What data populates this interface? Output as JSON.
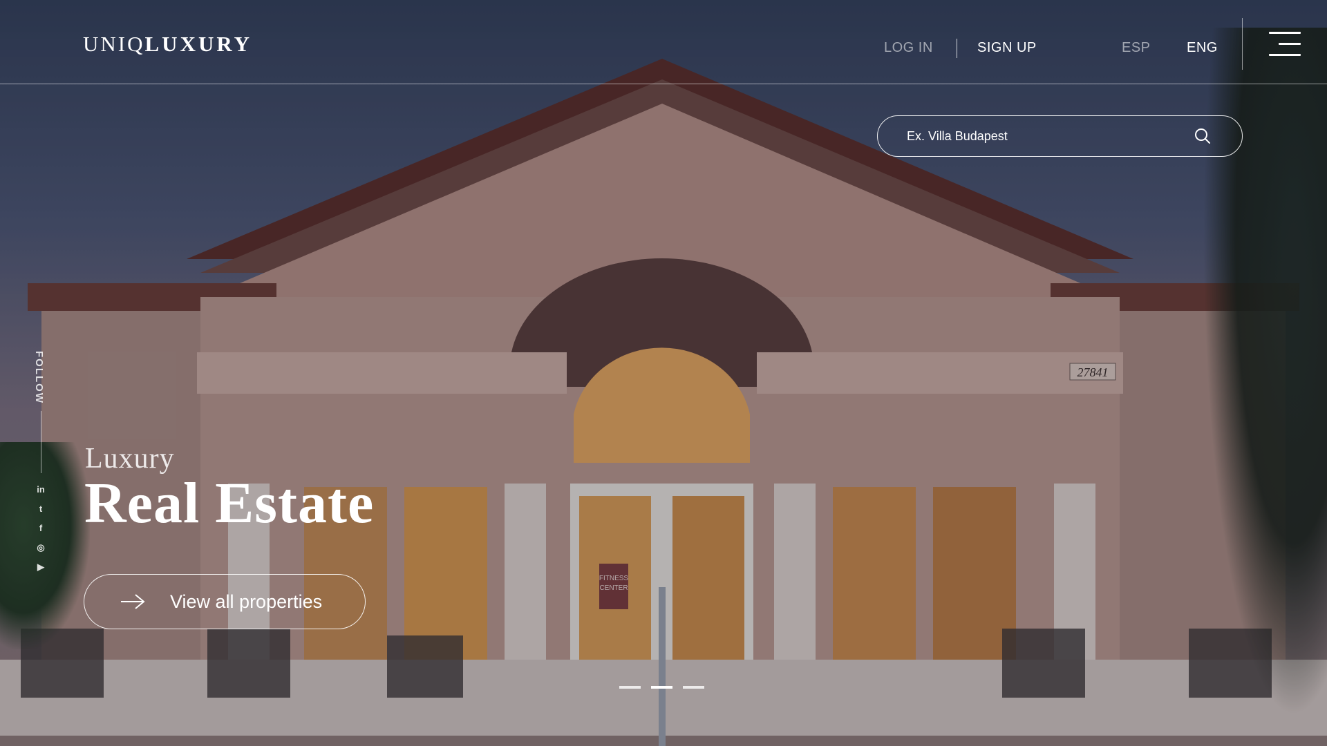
{
  "brand": {
    "logo_thin": "UNIQ",
    "logo_bold": "LUXURY"
  },
  "header": {
    "login_label": "LOG IN",
    "signup_label": "SIGN UP",
    "lang_es": "ESP",
    "lang_en": "ENG",
    "menu_icon": "hamburger-menu-icon"
  },
  "search": {
    "placeholder": "Ex. Villa Budapest",
    "icon": "search-icon"
  },
  "follow": {
    "label": "FOLLOW",
    "socials": [
      {
        "name": "linkedin-icon",
        "glyph": "in"
      },
      {
        "name": "twitter-icon",
        "glyph": "t"
      },
      {
        "name": "facebook-icon",
        "glyph": "f"
      },
      {
        "name": "instagram-icon",
        "glyph": "◎"
      },
      {
        "name": "youtube-icon",
        "glyph": "▶"
      }
    ]
  },
  "hero": {
    "subtitle": "Luxury",
    "title": "Real Estate",
    "cta_label": "View all properties",
    "cta_icon": "arrow-right-icon"
  },
  "slider": {
    "count": 3,
    "active_index": 1
  },
  "scene": {
    "house_number": "27841",
    "sign_text_1": "FITNESS",
    "sign_text_2": "CENTER"
  },
  "colors": {
    "text": "#ffffff",
    "dim_text": "rgba(255,255,255,0.55)",
    "sky": "#34405a"
  }
}
